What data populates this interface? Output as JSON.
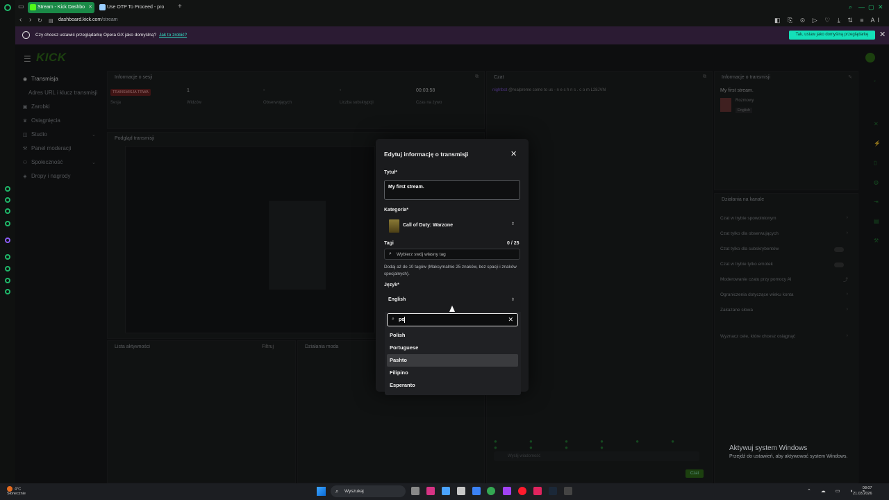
{
  "browser": {
    "tabs": [
      {
        "label": "Stream - Kick Dashbo",
        "active": true
      },
      {
        "label": "Use OTP To Proceed - pro",
        "active": false
      }
    ],
    "url_host": "dashboard.kick.com",
    "url_path": "/stream"
  },
  "banner": {
    "text": "Czy chcesz ustawić przeglądarkę Opera GX jako domyślną?",
    "link": "Jak to zrobić?",
    "button": "Tak, ustaw jako domyślną przeglądarkę"
  },
  "kick": {
    "logo": "KICK",
    "sidebar": [
      {
        "label": "Transmisja",
        "icon": "broadcast-icon"
      },
      {
        "label": "Adres URL i klucz transmisji",
        "icon": ""
      },
      {
        "label": "Zarobki",
        "icon": "money-icon"
      },
      {
        "label": "Osiągnięcia",
        "icon": "trophy-icon"
      },
      {
        "label": "Studio",
        "icon": "studio-icon"
      },
      {
        "label": "Panel moderacji",
        "icon": "moderation-icon"
      },
      {
        "label": "Społeczność",
        "icon": "community-icon"
      },
      {
        "label": "Dropy i nagrody",
        "icon": "gift-icon"
      }
    ],
    "session": {
      "title": "Informacje o sesji",
      "live_badge": "TRANSMISJA TRWA",
      "stats": [
        {
          "value": "1",
          "label": "Widzów"
        },
        {
          "value": "-",
          "label": "Obserwujących"
        },
        {
          "value": "-",
          "label": "Liczba subskrypcji"
        },
        {
          "value": "00:03:58",
          "label": "Czas na żywo"
        }
      ],
      "first_label": "Sesja"
    },
    "preview_title": "Podgląd transmisji",
    "activity_title": "Lista aktywności",
    "activity_filter": "Filtruj",
    "mod_actions_title": "Działania moda",
    "chat": {
      "title": "Czat",
      "message_user": "nightbot",
      "message_text": "@realpreme come to us - n e s h n s . c o m L28JVhl",
      "input_placeholder": "Wyślij wiadomość",
      "send": "Czat"
    },
    "stream_info": {
      "title": "Informacje o transmisji",
      "stream_title": "My first stream.",
      "category": "Rozmowy",
      "language": "English"
    },
    "channel_actions": {
      "title": "Działania na kanale",
      "rows": [
        {
          "label": "Czat w trybie spowolnionym",
          "control": "arrow"
        },
        {
          "label": "Czat tylko dla obserwujących",
          "control": "arrow"
        },
        {
          "label": "Czat tylko dla subskrybentów",
          "control": "toggle"
        },
        {
          "label": "Czat w trybie tylko emotek",
          "control": "toggle"
        },
        {
          "label": "Moderowanie czatu przy pomocy AI",
          "control": "external"
        },
        {
          "label": "Ograniczenia dotyczące wieku konta",
          "control": "arrow"
        },
        {
          "label": "Zakazane słowa",
          "control": "arrow"
        },
        {
          "label": "Wyznacz cele, które chcesz osiągnąć",
          "control": "arrow"
        }
      ]
    }
  },
  "modal": {
    "title": "Edytuj informację o transmisji",
    "title_label": "Tytuł*",
    "title_value": "My first stream.",
    "category_label": "Kategoria*",
    "category_value": "Call of Duty: Warzone",
    "tags_label": "Tagi",
    "tags_count": "0 / 25",
    "tags_placeholder": "Wybierz swój własny tag",
    "tags_help": "Dodaj aż do 10 tagów (Maksymalnie 25 znaków, bez spacji i znaków specjalnych).",
    "language_label": "Język*",
    "language_value": "English",
    "language_search": "po",
    "language_options": [
      "Polish",
      "Portuguese",
      "Pashto",
      "Filipino",
      "Esperanto"
    ],
    "hovered_option": "Pashto"
  },
  "windows": {
    "activate_title": "Aktywuj system Windows",
    "activate_sub": "Przejdź do ustawień, aby aktywować system Windows.",
    "search_placeholder": "Wyszukaj",
    "weather_temp": "4°C",
    "weather_desc": "Słonecznie",
    "time": "08:07",
    "date": "21.03.2026"
  }
}
